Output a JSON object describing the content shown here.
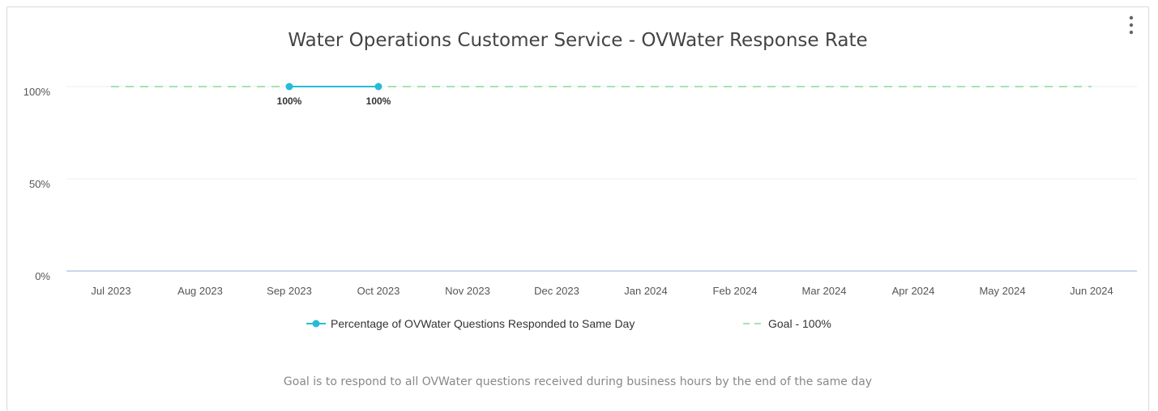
{
  "chart_data": {
    "type": "line",
    "title": "Water Operations Customer Service - OVWater Response Rate",
    "categories": [
      "Jul 2023",
      "Aug 2023",
      "Sep 2023",
      "Oct 2023",
      "Nov 2023",
      "Dec 2023",
      "Jan 2024",
      "Feb 2024",
      "Mar 2024",
      "Apr 2024",
      "May 2024",
      "Jun 2024"
    ],
    "y_ticks": [
      "0%",
      "50%",
      "100%"
    ],
    "y_tick_values": [
      0,
      50,
      100
    ],
    "ylim": [
      0,
      100
    ],
    "grid": true,
    "legend_position": "bottom",
    "series": [
      {
        "name": "Percentage of OVWater Questions Responded to Same Day",
        "style": "solid-with-markers",
        "color": "#26bcd7",
        "values": [
          null,
          null,
          100,
          100,
          null,
          null,
          null,
          null,
          null,
          null,
          null,
          null
        ],
        "data_labels": [
          null,
          null,
          "100%",
          "100%",
          null,
          null,
          null,
          null,
          null,
          null,
          null,
          null
        ]
      },
      {
        "name": "Goal - 100%",
        "style": "dashed",
        "color": "#a6e3b0",
        "values": [
          100,
          100,
          100,
          100,
          100,
          100,
          100,
          100,
          100,
          100,
          100,
          100
        ]
      }
    ],
    "footnote": "Goal is to respond to all OVWater questions received during business hours by the end of the same day"
  },
  "colors": {
    "grid": "#eeeeee",
    "axis": "#ccd6eb",
    "text": "#555555"
  },
  "icons": {
    "menu": "vertical-ellipsis-icon"
  }
}
